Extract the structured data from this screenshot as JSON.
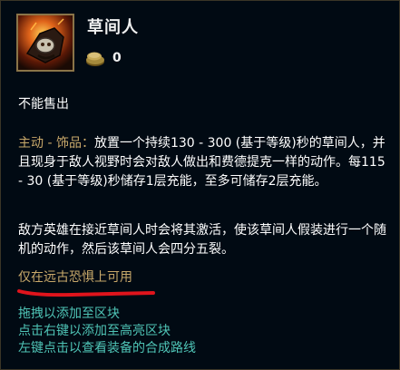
{
  "item": {
    "title": "草间人",
    "cost": "0",
    "icon": "scarecrow-effigy-lantern-icon",
    "gold_icon": "gold-coin-stack-icon"
  },
  "description": {
    "unsellable": "不能售出",
    "active_label": "主动 - 饰品：",
    "active_text": "放置一个持续130 - 300 (基于等级)秒的草间人，并且现身于敌人视野时会对敌人做出和费德提克一样的动作。每115 - 30 (基于等级)秒储存1层充能，至多可储存2层充能。",
    "enemy_text": "敌方英雄在接近草间人时会将其激活，使该草间人假装进行一个随机的动作，然后该草间人会四分五裂。",
    "availability": "仅在远古恐惧上可用"
  },
  "hints": [
    "拖拽以添加至区块",
    "点击右键以添加至高亮区块",
    "左键点击以查看装备的合成路线"
  ],
  "colors": {
    "background": "#010a13",
    "gold_text": "#c8a86a",
    "hint_text": "#4fc4b6",
    "annotation_red": "#e0141c"
  }
}
